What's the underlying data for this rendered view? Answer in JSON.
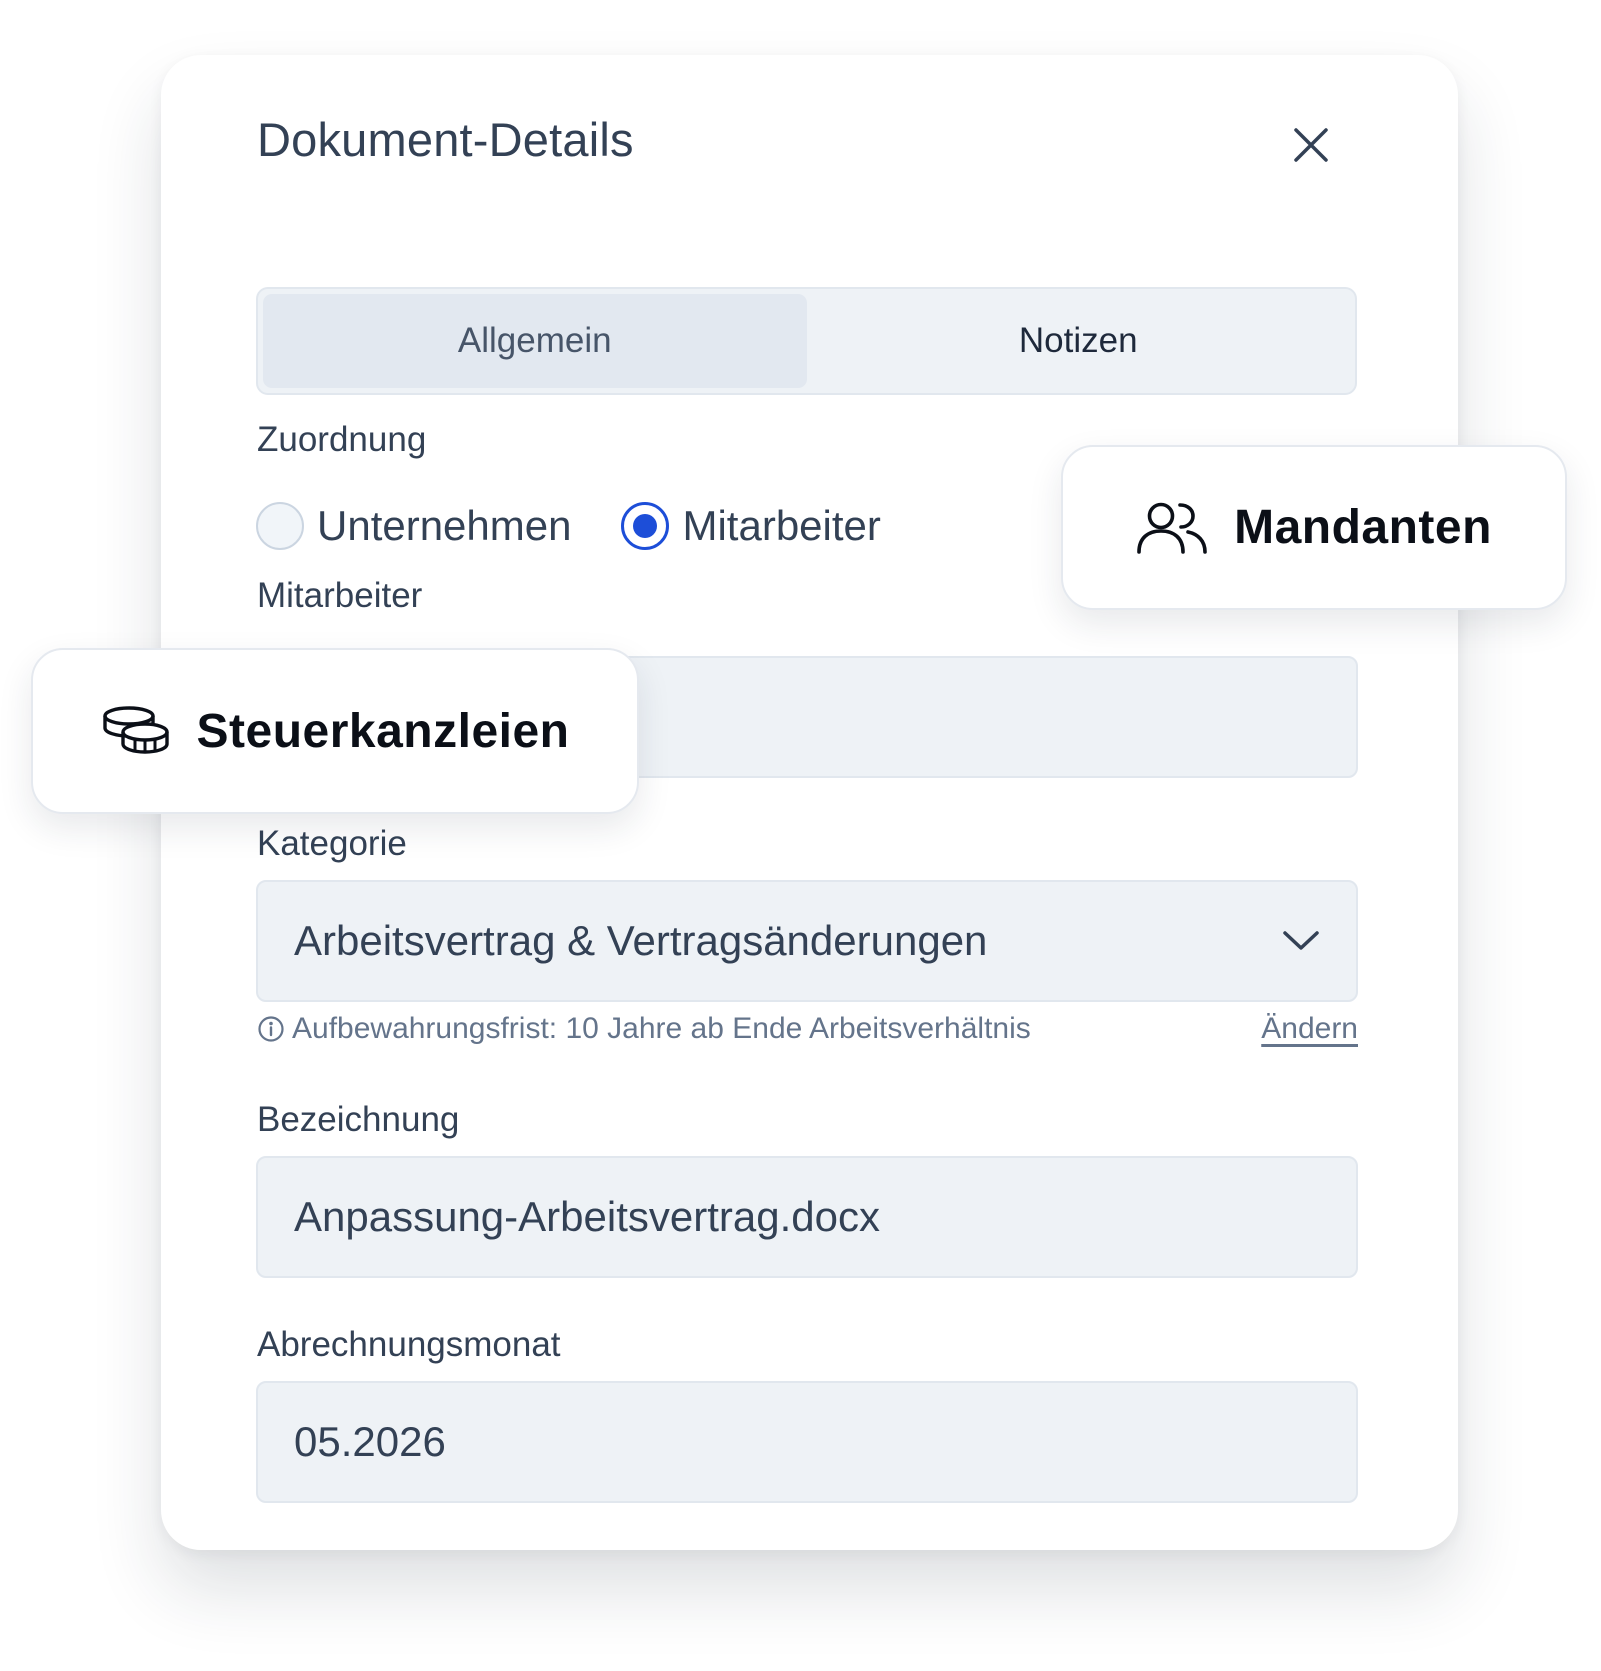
{
  "dialog": {
    "title": "Dokument-Details",
    "close_icon": "close-icon"
  },
  "tabs": [
    {
      "label": "Allgemein",
      "active": true
    },
    {
      "label": "Notizen",
      "active": false
    }
  ],
  "assignment": {
    "label": "Zuordnung",
    "options": [
      {
        "label": "Unternehmen",
        "checked": false
      },
      {
        "label": "Mitarbeiter",
        "checked": true
      }
    ]
  },
  "employee": {
    "label": "Mitarbeiter",
    "value": ""
  },
  "category": {
    "label": "Kategorie",
    "value": "Arbeitsvertrag & Vertragsänderungen",
    "icon": "chevron-down-icon",
    "hint": "Aufbewahrungsfrist: 10 Jahre ab Ende Arbeitsverhältnis",
    "hint_icon": "info-icon",
    "change_link": "Ändern"
  },
  "designation": {
    "label": "Bezeichnung",
    "value": "Anpassung-Arbeitsvertrag.docx"
  },
  "billing_month": {
    "label": "Abrechnungsmonat",
    "value": "05.2026"
  },
  "badges": {
    "mandanten": {
      "label": "Mandanten",
      "icon": "users-icon"
    },
    "steuerkanzleien": {
      "label": "Steuerkanzleien",
      "icon": "coins-icon"
    }
  },
  "colors": {
    "accent": "#1d4ed8",
    "text": "#334155",
    "field_bg": "#eef2f6",
    "border": "#e1e7ee"
  }
}
